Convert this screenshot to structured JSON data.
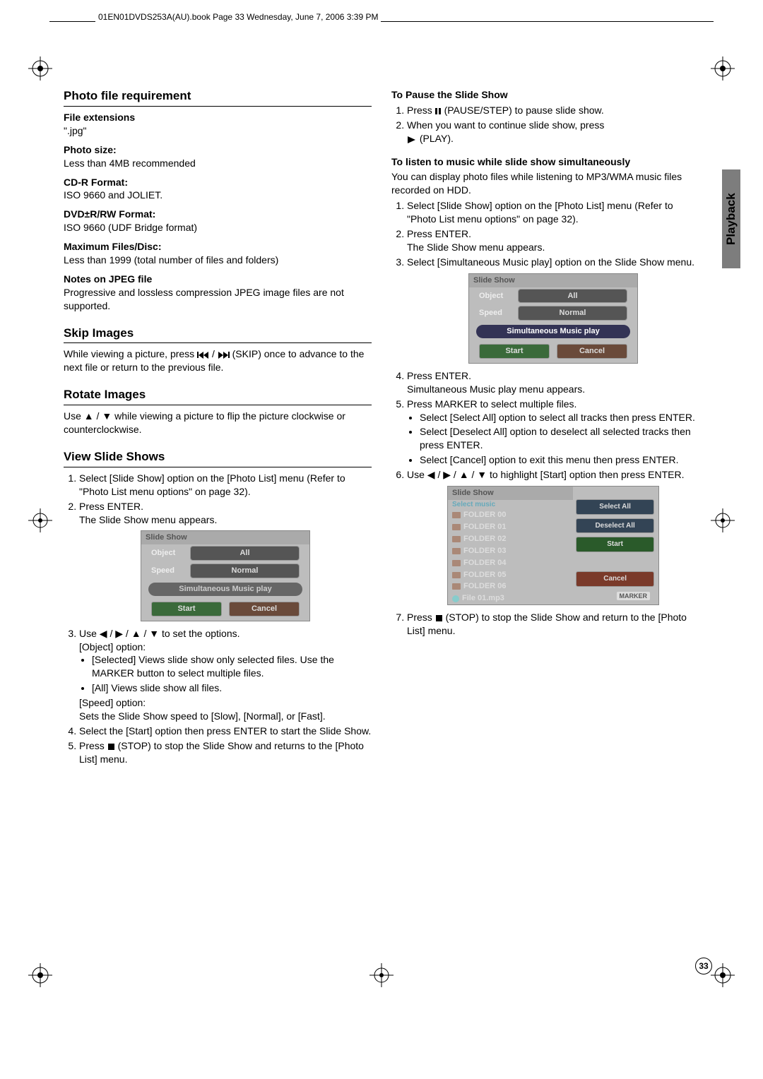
{
  "header": "01EN01DVDS253A(AU).book  Page 33  Wednesday, June 7, 2006  3:39 PM",
  "tab": "Playback",
  "page_number": "33",
  "left": {
    "photo_req_title": "Photo file requirement",
    "file_ext_h": "File extensions",
    "file_ext_v": "\".jpg\"",
    "photo_size_h": "Photo size:",
    "photo_size_v": "Less than 4MB recommended",
    "cdr_h": "CD-R Format:",
    "cdr_v": "ISO 9660 and JOLIET.",
    "dvd_h": "DVD±R/RW Format:",
    "dvd_v": "ISO 9660 (UDF Bridge format)",
    "max_h": "Maximum Files/Disc:",
    "max_v": "Less than 1999 (total number of files and folders)",
    "notes_h": "Notes on JPEG file",
    "notes_v": "Progressive and lossless compression JPEG image files are not supported.",
    "skip_title": "Skip Images",
    "skip_p1": "While viewing a picture, press ",
    "skip_p2": " (SKIP) once to advance to the next file or return to the previous file.",
    "rotate_title": "Rotate Images",
    "rotate_p1": "Use ",
    "rotate_p2": " while viewing a picture to flip the picture clockwise or counterclockwise.",
    "view_title": "View Slide Shows",
    "v1": "Select [Slide Show] option on the [Photo List] menu (Refer to \"Photo List menu options\" on page 32).",
    "v2a": "Press ENTER.",
    "v2b": "The Slide Show menu appears.",
    "v3a": "Use ",
    "v3b": " to set the options.",
    "v3_obj": "[Object] option:",
    "v3_sel": "[Selected] Views slide show only selected files. Use the MARKER button to select multiple files.",
    "v3_all": "[All] Views slide show all files.",
    "v3_speed": "[Speed] option:",
    "v3_speed_v": "Sets the Slide Show speed to [Slow], [Normal], or [Fast].",
    "v4": "Select the [Start] option then press ENTER to start the Slide Show.",
    "v5a": "Press ",
    "v5b": " (STOP) to stop the Slide Show and returns to the [Photo List] menu."
  },
  "right": {
    "pause_h": "To Pause the Slide Show",
    "p1a": "Press ",
    "p1b": " (PAUSE/STEP) to pause slide show.",
    "p2a": "When you want to continue slide show, press ",
    "p2b": " (PLAY).",
    "listen_h": "To listen to music while slide show simultaneously",
    "listen_p": "You can display photo files while listening to MP3/WMA music files recorded on HDD.",
    "l1": "Select [Slide Show] option on the [Photo List] menu (Refer to \"Photo List menu options\" on page 32).",
    "l2a": "Press ENTER.",
    "l2b": "The Slide Show menu appears.",
    "l3": "Select [Simultaneous Music play] option on the Slide Show menu.",
    "l4a": "Press ENTER.",
    "l4b": "Simultaneous Music play menu appears.",
    "l5": "Press MARKER to select multiple files.",
    "l5a": "Select [Select All] option to select all tracks then press ENTER.",
    "l5b": "Select [Deselect All] option to deselect all selected tracks then press ENTER.",
    "l5c": "Select [Cancel] option to exit this menu then press ENTER.",
    "l6a": "Use ",
    "l6b": " to highlight [Start] option then press ENTER.",
    "l7a": "Press ",
    "l7b": " (STOP) to stop the Slide Show and return to the [Photo List] menu."
  },
  "menu": {
    "title": "Slide Show",
    "object": "Object",
    "object_v": "All",
    "speed": "Speed",
    "speed_v": "Normal",
    "sim": "Simultaneous Music play",
    "start": "Start",
    "cancel": "Cancel"
  },
  "music": {
    "title": "Slide Show",
    "sub": "Select  music",
    "folders": [
      "FOLDER 00",
      "FOLDER 01",
      "FOLDER 02",
      "FOLDER 03",
      "FOLDER 04",
      "FOLDER 05",
      "FOLDER 06"
    ],
    "file": "File 01.mp3",
    "select_all": "Select All",
    "deselect_all": "Deselect All",
    "start": "Start",
    "cancel": "Cancel",
    "marker": "MARKER"
  }
}
